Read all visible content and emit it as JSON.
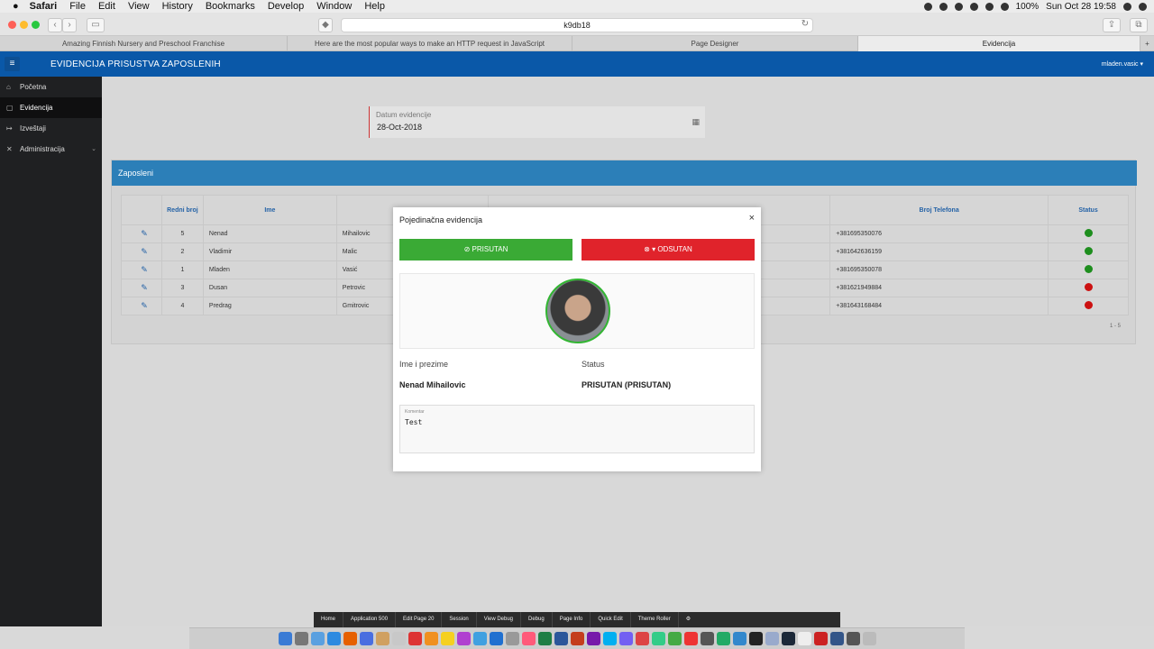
{
  "menubar": {
    "apple": "",
    "app": "Safari",
    "items": [
      "File",
      "Edit",
      "View",
      "History",
      "Bookmarks",
      "Develop",
      "Window",
      "Help"
    ],
    "battery": "100%",
    "clock": "Sun Oct 28  19:58"
  },
  "browser": {
    "address": "k9db18",
    "tabs": [
      "Amazing Finnish Nursery and Preschool Franchise",
      "Here are the most popular ways to make an HTTP request in JavaScript",
      "Page Designer",
      "Evidencija"
    ],
    "active_tab": 3
  },
  "app": {
    "title": "EVIDENCIJA PRISUSTVA ZAPOSLENIH",
    "user": "mladen.vasic ▾",
    "nav": [
      "Početna",
      "Evidencija",
      "Izveštaji",
      "Administracija"
    ]
  },
  "date_field": {
    "label": "Datum evidencije",
    "value": "28-Oct-2018"
  },
  "region": {
    "title": "Zaposleni",
    "columns": [
      "Redni broj",
      "Ime",
      "Broj Telefona",
      "Status"
    ],
    "rows": [
      {
        "broj": "5",
        "ime": "Nenad",
        "prezime": "Mihailovic",
        "telefon": "+381695350076",
        "status": "#1e8e1e"
      },
      {
        "broj": "2",
        "ime": "Vladimir",
        "prezime": "Malic",
        "telefon": "+381642636159",
        "status": "#1e8e1e"
      },
      {
        "broj": "1",
        "ime": "Mladen",
        "prezime": "Vasić",
        "telefon": "+381695350078",
        "status": "#1e8e1e"
      },
      {
        "broj": "3",
        "ime": "Dusan",
        "prezime": "Petrovic",
        "telefon": "+381621949884",
        "status": "#cc1111"
      },
      {
        "broj": "4",
        "ime": "Predrag",
        "prezime": "Gmitrovic",
        "telefon": "+381643168484",
        "status": "#cc1111"
      }
    ],
    "pagination": "1 - 5"
  },
  "modal": {
    "title": "Pojedinačna evidencija",
    "present_label": "PRISUTAN",
    "absent_label": "ODSUTAN",
    "present_color": "#3aaa35",
    "absent_color": "#e0232b",
    "name_label": "Ime i prezime",
    "status_label": "Status",
    "name_value": "Nenad Mihailovic",
    "status_value": "PRISUTAN (PRISUTAN)",
    "comment_label": "Komentar",
    "comment_value": "Test"
  },
  "devbar": [
    "Home",
    "Application 500",
    "Edit Page 20",
    "Session",
    "View Debug",
    "Debug",
    "Page Info",
    "Quick Edit",
    "Theme Roller"
  ]
}
